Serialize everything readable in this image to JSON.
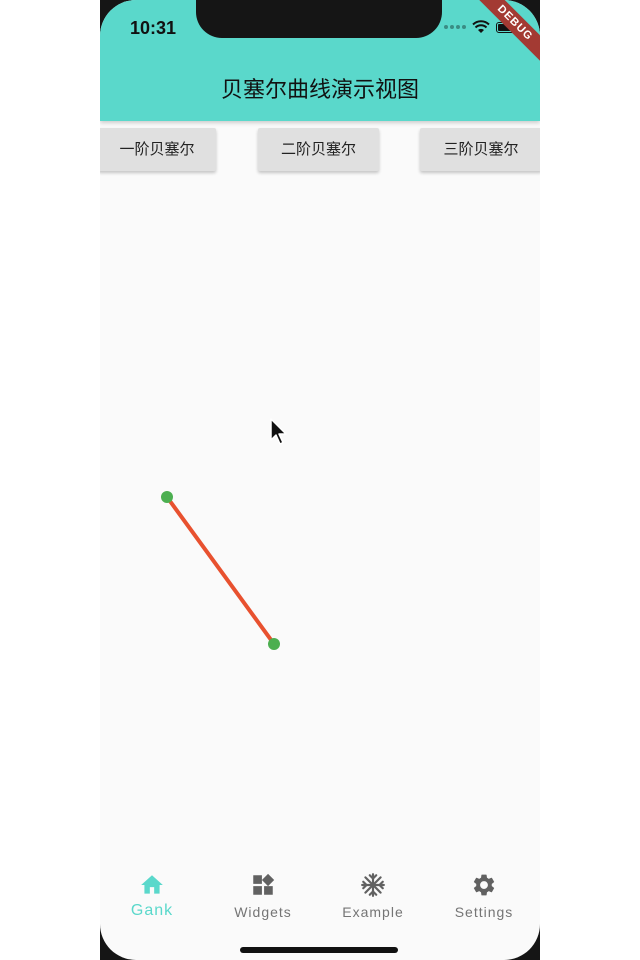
{
  "status_bar": {
    "time": "10:31",
    "debug_banner": "DEBUG"
  },
  "app_bar": {
    "title": "贝塞尔曲线演示视图",
    "background_color": "#5ad8cb"
  },
  "buttons": [
    {
      "label": "一阶贝塞尔"
    },
    {
      "label": "二阶贝塞尔"
    },
    {
      "label": "三阶贝塞尔"
    }
  ],
  "bezier_demo": {
    "order": 1,
    "line_color": "#e8512f",
    "point_color": "#4caf50"
  },
  "bottom_nav": {
    "active_color": "#5ad8cb",
    "items": [
      {
        "label": "Gank",
        "icon": "home-icon",
        "active": true
      },
      {
        "label": "Widgets",
        "icon": "widgets-icon",
        "active": false
      },
      {
        "label": "Example",
        "icon": "snowflake-icon",
        "active": false
      },
      {
        "label": "Settings",
        "icon": "gear-icon",
        "active": false
      }
    ]
  }
}
